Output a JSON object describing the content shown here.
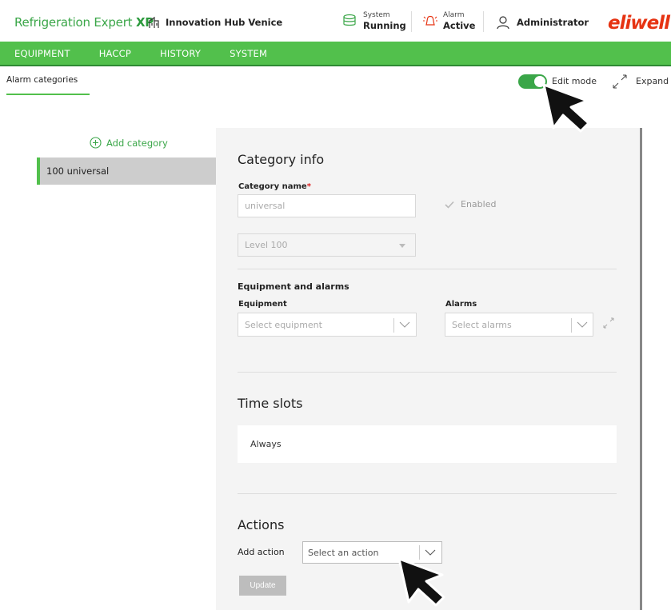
{
  "header": {
    "app_title_prefix": "Refrigeration Expert ",
    "app_title_suffix": "XP",
    "site_name": "Innovation Hub Venice",
    "system_label": "System",
    "system_value": "Running",
    "alarm_label": "Alarm",
    "alarm_value": "Active",
    "user_name": "Administrator",
    "brand_logo": "eliwell",
    "brand_color": "#e63312"
  },
  "nav": {
    "items": [
      {
        "label": "EQUIPMENT"
      },
      {
        "label": "HACCP"
      },
      {
        "label": "HISTORY"
      },
      {
        "label": "SYSTEM"
      }
    ],
    "accent": "#52c04c"
  },
  "toolbar": {
    "tab_label": "Alarm categories",
    "edit_mode_label": "Edit mode",
    "edit_mode_on": true,
    "expand_label": "Expand"
  },
  "sidebar": {
    "add_label": "Add category",
    "items": [
      {
        "label": "100 universal",
        "selected": true
      }
    ]
  },
  "category_info": {
    "title": "Category info",
    "name_label": "Category name",
    "required_mark": "*",
    "name_value": "universal",
    "enabled_label": "Enabled",
    "enabled_checked": true,
    "level_value": "Level 100"
  },
  "equipment_alarms": {
    "title": "Equipment and alarms",
    "equipment_label": "Equipment",
    "equipment_placeholder": "Select equipment",
    "alarms_label": "Alarms",
    "alarms_placeholder": "Select alarms"
  },
  "time_slots": {
    "title": "Time slots",
    "value": "Always"
  },
  "actions": {
    "title": "Actions",
    "add_action_label": "Add action",
    "action_placeholder": "Select an action",
    "update_label": "Update"
  }
}
